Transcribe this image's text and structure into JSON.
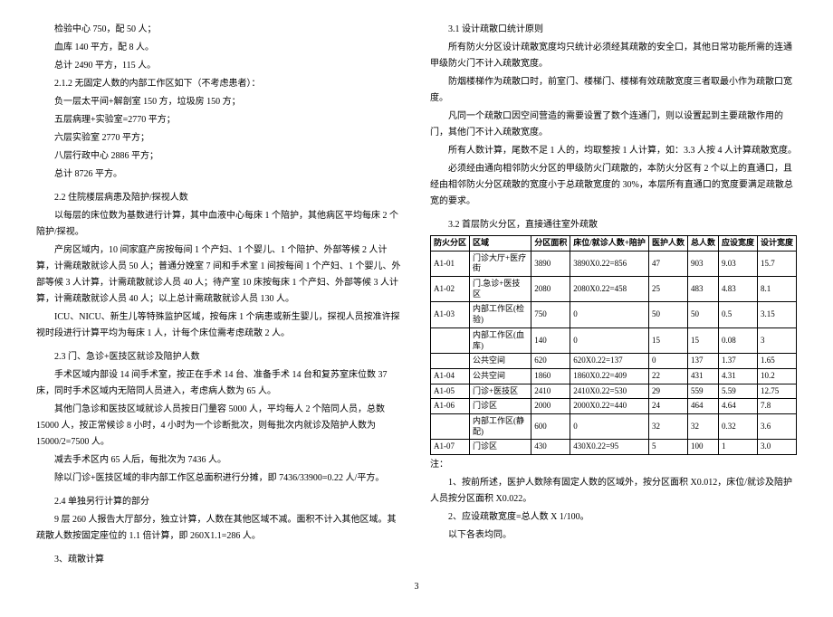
{
  "left": {
    "p1": "检验中心 750，配 50 人；",
    "p2": "血库 140 平方，配 8 人。",
    "p3": "总计 2490 平方，115 人。",
    "p4": "2.1.2 无固定人数的内部工作区如下（不考虑患者）：",
    "p5": "负一层太平间+解剖室 150 方，垃圾房 150 方；",
    "p6": "五层病理+实验室=2770 平方；",
    "p7": "六层实验室 2770 平方；",
    "p8": "八层行政中心 2886 平方；",
    "p9": "总计 8726 平方。",
    "s22_title": "2.2 住院楼层病患及陪护/探视人数",
    "s22_p1": "以每层的床位数为基数进行计算，其中血液中心每床 1 个陪护，其他病区平均每床 2 个陪护/探视。",
    "s22_p2": "产房区域内，10 间家庭产房按每间 1 个产妇、1 个婴儿、1 个陪护、外部等候 2 人计算，计需疏散就诊人员 50 人；普通分娩室 7 间和手术室 1 间按每间 1 个产妇、1 个婴儿、外部等候 3 人计算，计需疏散就诊人员 40 人；待产室 10 床按每床 1 个产妇、外部等候 3 人计算，计需疏散就诊人员 40 人；以上总计需疏散就诊人员 130 人。",
    "s22_p3": "ICU、NICU、新生儿等特殊监护区域，按每床 1 个病患或新生婴儿，探视人员按准许探视时段进行计算平均为每床 1 人，计每个床位需考虑疏散 2 人。",
    "s23_title": "2.3 门、急诊+医技区就诊及陪护人数",
    "s23_p1": "手术区域内部设 14 间手术室，按正在手术 14 台、准备手术 14 台和复苏室床位数 37 床，同时手术区域内无陪同人员进入，考虑病人数为 65 人。",
    "s23_p2": "其他门急诊和医技区域就诊人员按日门量容 5000 人，平均每人 2 个陪同人员，总数 15000 人，按正常候诊 8 小时，4 小时为一个诊断批次，则每批次内就诊及陪护人数为 15000/2=7500 人。",
    "s23_p3": "减去手术区内 65 人后，每批次为 7436 人。",
    "s23_p4": "除以门诊+医技区域的非内部工作区总面积进行分摊，即 7436/33900=0.22 人/平方。",
    "s24_title": "2.4 单独另行计算的部分",
    "s24_p1": "9 层 260 人报告大厅部分，独立计算，人数在其他区域不减。面积不计入其他区域。其疏散人数按固定座位的 1.1 倍计算，即 260X1.1=286 人。",
    "s3_title": "3、疏散计算"
  },
  "right": {
    "s31_title": "3.1 设计疏散口统计原则",
    "s31_p1": "所有防火分区设计疏散宽度均只统计必须经其疏散的安全口，其他日常功能所需的连通甲级防火门不计入疏散宽度。",
    "s31_p2": "防烟楼梯作为疏散口时，前室门、楼梯门、楼梯有效疏散宽度三者取最小作为疏散口宽度。",
    "s31_p3": "凡同一个疏散口因空间营造的需要设置了数个连通门，则以设置起到主要疏散作用的门，其他门不计入疏散宽度。",
    "s31_p4": "所有人数计算，尾数不足 1 人的，均取整按 1 人计算，如：3.3 人按 4 人计算疏散宽度。",
    "s31_p5": "必须经由通向相邻防火分区的甲级防火门疏散的，本防火分区有 2 个以上的直通口，且经由相邻防火分区疏散的宽度小于总疏散宽度的 30%，本层所有直通口的宽度要满足疏散总宽的要求。",
    "s32_title": "3.2 首层防火分区，直接通往室外疏散",
    "table": {
      "headers": [
        "防火分区",
        "区域",
        "分区面积",
        "床位/就诊人数+陪护",
        "医护人数",
        "总人数",
        "应设宽度",
        "设计宽度"
      ],
      "rows": [
        [
          "A1-01",
          "门诊大厅+医疗街",
          "3890",
          "3890X0.22=856",
          "47",
          "903",
          "9.03",
          "15.7"
        ],
        [
          "A1-02",
          "门.急诊+医技区",
          "2080",
          "2080X0.22=458",
          "25",
          "483",
          "4.83",
          "8.1"
        ],
        [
          "A1-03",
          "内部工作区(检验)",
          "750",
          "0",
          "50",
          "50",
          "0.5",
          "3.15"
        ],
        [
          "",
          "内部工作区(血库)",
          "140",
          "0",
          "15",
          "15",
          "0.08",
          "3"
        ],
        [
          "",
          "公共空间",
          "620",
          "620X0.22=137",
          "0",
          "137",
          "1.37",
          "1.65"
        ],
        [
          "A1-04",
          "公共空间",
          "1860",
          "1860X0.22=409",
          "22",
          "431",
          "4.31",
          "10.2"
        ],
        [
          "A1-05",
          "门诊+医技区",
          "2410",
          "2410X0.22=530",
          "29",
          "559",
          "5.59",
          "12.75"
        ],
        [
          "A1-06",
          "门诊区",
          "2000",
          "2000X0.22=440",
          "24",
          "464",
          "4.64",
          "7.8"
        ],
        [
          "",
          "内部工作区(静配)",
          "600",
          "0",
          "32",
          "32",
          "0.32",
          "3.6"
        ],
        [
          "A1-07",
          "门诊区",
          "430",
          "430X0.22=95",
          "5",
          "100",
          "1",
          "3.0"
        ]
      ]
    },
    "notes_label": "注：",
    "note1": "1、按前所述，医护人数除有固定人数的区域外，按分区面积 X0.012，床位/就诊及陪护人员按分区面积 X0.022。",
    "note2": "2、应设疏散宽度=总人数 X 1/100。",
    "note3": "以下各表均同。"
  },
  "page_number": "3"
}
